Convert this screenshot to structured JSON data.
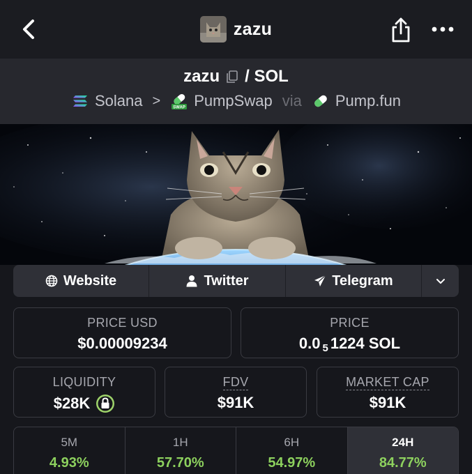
{
  "header": {
    "title": "zazu"
  },
  "pair": {
    "base": "zazu",
    "quote": "/ SOL",
    "chain": "Solana",
    "dex": "PumpSwap",
    "via": "via",
    "launchpad": "Pump.fun",
    "dex_badge": "SWAP"
  },
  "links": [
    {
      "label": "Website",
      "icon": "globe-icon"
    },
    {
      "label": "Twitter",
      "icon": "user-icon"
    },
    {
      "label": "Telegram",
      "icon": "paper-plane-icon"
    }
  ],
  "stats": {
    "price_usd": {
      "label": "PRICE USD",
      "value": "$0.00009234"
    },
    "price": {
      "label": "PRICE",
      "value_prefix": "0.0",
      "value_subscript": "5",
      "value_suffix": "1224 SOL"
    },
    "liquidity": {
      "label": "LIQUIDITY",
      "value": "$28K"
    },
    "fdv": {
      "label": "FDV",
      "value": "$91K"
    },
    "market_cap": {
      "label": "MARKET CAP",
      "value": "$91K"
    }
  },
  "timeframes": [
    {
      "label": "5M",
      "value": "4.93%"
    },
    {
      "label": "1H",
      "value": "57.70%"
    },
    {
      "label": "6H",
      "value": "54.97%"
    },
    {
      "label": "24H",
      "value": "84.77%",
      "active": true
    }
  ],
  "colors": {
    "positive": "#8dd15e",
    "background": "#16171c",
    "lock": "#9ed36a"
  }
}
